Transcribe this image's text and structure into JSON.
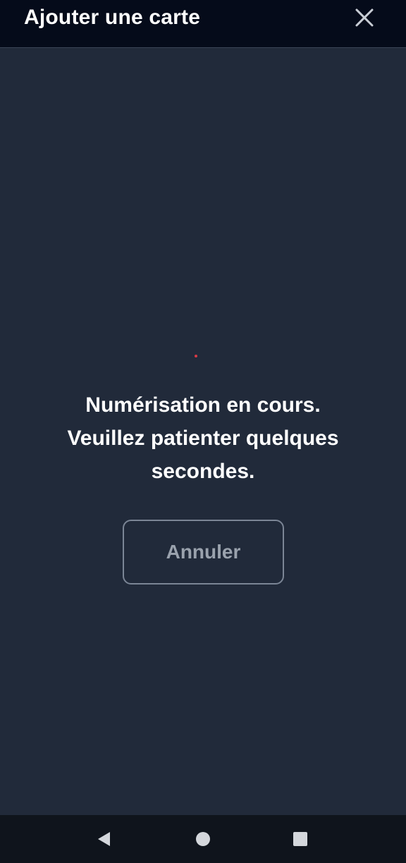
{
  "header": {
    "title": "Ajouter une carte",
    "close_icon": "close-icon"
  },
  "main": {
    "message_lines": [
      "Numérisation en cours.",
      "Veuillez patienter quelques",
      "secondes."
    ],
    "cancel_label": "Annuler"
  },
  "navbar": {
    "back_icon": "back-triangle-icon",
    "home_icon": "home-circle-icon",
    "recents_icon": "recents-square-icon"
  },
  "colors": {
    "header_bg": "#050b1a",
    "body_bg": "#212a3a",
    "accent_dot": "#d83a46",
    "button_border": "#7b8595",
    "button_text": "#9aa2ad"
  }
}
